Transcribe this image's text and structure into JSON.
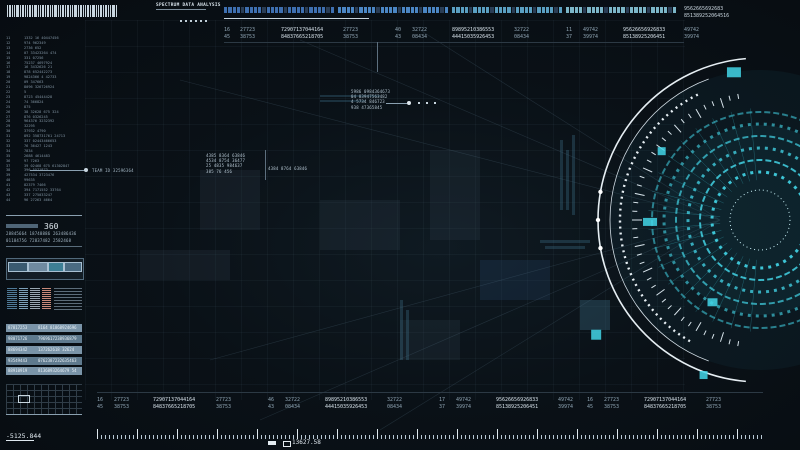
{
  "header": {
    "title": "SPECTRUM DATA ANALYSIS",
    "top_right_1": "9562665692683",
    "top_right_2": "851389252064516"
  },
  "colors": {
    "accent_cyan": "#43d6e8",
    "panel_blue": "#7a94a8",
    "text_light": "#d7e2ea",
    "text_dim": "#8fa4b3"
  },
  "table_top": {
    "rows": [
      [
        "16",
        "27723",
        "72907137044164",
        "27723",
        "40",
        "32722",
        "89895210386553",
        "32722",
        "11",
        "49742",
        "95626656926833",
        "49742"
      ],
      [
        "45",
        "38753",
        "84837665218705",
        "38753",
        "43",
        "08434",
        "44415035926453",
        "08434",
        "37",
        "39974",
        "85138925206451",
        "39974"
      ]
    ]
  },
  "table_bottom": {
    "rows": [
      [
        "16",
        "27723",
        "72907137044164",
        "27723",
        "46",
        "32722",
        "89895210386553",
        "32722",
        "17",
        "49742",
        "95626656926833",
        "49742",
        "16",
        "27723",
        "72907137044164",
        "27723"
      ],
      [
        "45",
        "38753",
        "84837665218705",
        "38753",
        "43",
        "08434",
        "44415035926453",
        "08434",
        "37",
        "39974",
        "85138925206451",
        "39974",
        "45",
        "38753",
        "84837665218705",
        "38753"
      ]
    ]
  },
  "left_list": [
    [
      "11",
      "1332 16 40447456"
    ],
    [
      "12",
      "974 962349"
    ],
    [
      "13",
      "2736 652"
    ],
    [
      "14",
      "07 33423264 474"
    ],
    [
      "15",
      "331 07256"
    ],
    [
      "16",
      "75237 4697924"
    ],
    [
      "17",
      "16 3432626 21"
    ],
    [
      "18",
      "878 652442273"
    ],
    [
      "19",
      "9824366 4 42733"
    ],
    [
      "20",
      "09 347663"
    ],
    [
      "21",
      "8096 326726924"
    ],
    [
      "22",
      "5"
    ],
    [
      "23",
      "8723 45444428"
    ],
    [
      "24",
      "74 366824"
    ],
    [
      "25",
      "875"
    ],
    [
      "26",
      "38 32628 675 324"
    ],
    [
      "27",
      "876 0326245"
    ],
    [
      "28",
      "964376 3232392"
    ],
    [
      "29",
      "32295"
    ],
    [
      "30",
      "37932 4790"
    ],
    [
      "31",
      "892 358731761 24713"
    ],
    [
      "32",
      "337 02443466653"
    ],
    [
      "33",
      "76 36427 1243"
    ],
    [
      "34",
      "7834"
    ],
    [
      "35",
      "2688 4614483"
    ],
    [
      "36",
      "97 7263"
    ],
    [
      "37",
      "39 02468 675 61302847"
    ],
    [
      "38",
      "396 5571873"
    ],
    [
      "39",
      "427534 3723476"
    ],
    [
      "40",
      "99635"
    ],
    [
      "41",
      "82379 7466"
    ],
    [
      "42",
      "394 7171552 33764"
    ],
    [
      "43",
      "337 275033247"
    ],
    [
      "44",
      "96 27263 4664"
    ]
  ],
  "marker_left": "TEAM ID 32596364",
  "left_panel": {
    "big_value": "360",
    "line1": "28845664 18748886 263486436",
    "line2": "01184756 72837482 2582468"
  },
  "chip_rows": [
    [
      "87817253",
      "8164 81868924696"
    ],
    [
      "98071726",
      "7969617238936879"
    ],
    [
      "88694342",
      "137262618 32624"
    ],
    [
      "93549443",
      "0762387232635463"
    ],
    [
      "88910919",
      "8136893264679 54"
    ]
  ],
  "bottom_left_value": "-5125.844",
  "bottom_center_value": "13627.58",
  "floating_labels": {
    "center_top": [
      "5986 0984364673",
      "04 83947563482",
      "4 5734 846723",
      "938 47365845"
    ],
    "center_mid": [
      "4385 8364 63846",
      "4534 8754 36477",
      "25 4835 984637",
      "385 76 456"
    ],
    "center_mid2": "4384 8764 63846"
  }
}
